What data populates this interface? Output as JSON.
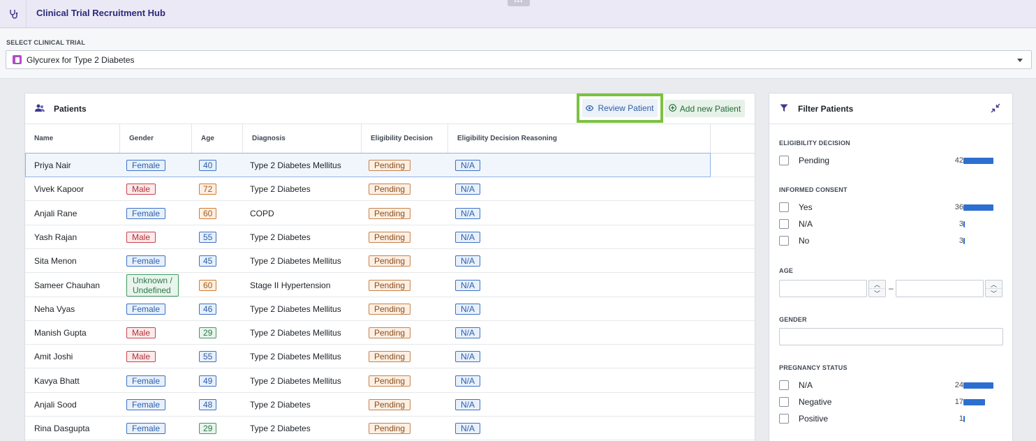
{
  "app": {
    "title": "Clinical Trial Recruitment Hub",
    "grip": "•••"
  },
  "trial": {
    "label": "SELECT CLINICAL TRIAL",
    "selected": "Glycurex for Type 2 Diabetes"
  },
  "patients": {
    "title": "Patients",
    "review_label": "Review Patient",
    "add_label": "Add new Patient",
    "columns": [
      "Name",
      "Gender",
      "Age",
      "Diagnosis",
      "Eligibility Decision",
      "Eligibility Decision Reasoning"
    ],
    "rows": [
      {
        "name": "Priya Nair",
        "gender": "Female",
        "age": "40",
        "diagnosis": "Type 2 Diabetes Mellitus",
        "decision": "Pending",
        "reasoning": "N/A"
      },
      {
        "name": "Vivek Kapoor",
        "gender": "Male",
        "age": "72",
        "diagnosis": "Type 2 Diabetes",
        "decision": "Pending",
        "reasoning": "N/A"
      },
      {
        "name": "Anjali Rane",
        "gender": "Female",
        "age": "60",
        "diagnosis": "COPD",
        "decision": "Pending",
        "reasoning": "N/A"
      },
      {
        "name": "Yash Rajan",
        "gender": "Male",
        "age": "55",
        "diagnosis": "Type 2 Diabetes",
        "decision": "Pending",
        "reasoning": "N/A"
      },
      {
        "name": "Sita Menon",
        "gender": "Female",
        "age": "45",
        "diagnosis": "Type 2 Diabetes Mellitus",
        "decision": "Pending",
        "reasoning": "N/A"
      },
      {
        "name": "Sameer Chauhan",
        "gender": "Unknown / Undefined",
        "gender_line1": "Unknown /",
        "gender_line2": "Undefined",
        "age": "60",
        "diagnosis": "Stage II Hypertension",
        "decision": "Pending",
        "reasoning": "N/A"
      },
      {
        "name": "Neha Vyas",
        "gender": "Female",
        "age": "46",
        "diagnosis": "Type 2 Diabetes Mellitus",
        "decision": "Pending",
        "reasoning": "N/A"
      },
      {
        "name": "Manish Gupta",
        "gender": "Male",
        "age": "29",
        "diagnosis": "Type 2 Diabetes Mellitus",
        "decision": "Pending",
        "reasoning": "N/A"
      },
      {
        "name": "Amit Joshi",
        "gender": "Male",
        "age": "55",
        "diagnosis": "Type 2 Diabetes Mellitus",
        "decision": "Pending",
        "reasoning": "N/A"
      },
      {
        "name": "Kavya Bhatt",
        "gender": "Female",
        "age": "49",
        "diagnosis": "Type 2 Diabetes Mellitus",
        "decision": "Pending",
        "reasoning": "N/A"
      },
      {
        "name": "Anjali Sood",
        "gender": "Female",
        "age": "48",
        "diagnosis": "Type 2 Diabetes",
        "decision": "Pending",
        "reasoning": "N/A"
      },
      {
        "name": "Rina Dasgupta",
        "gender": "Female",
        "age": "29",
        "diagnosis": "Type 2 Diabetes",
        "decision": "Pending",
        "reasoning": "N/A"
      }
    ]
  },
  "filter": {
    "title": "Filter Patients",
    "eligibility": {
      "label": "ELIGIBILITY DECISION",
      "options": [
        {
          "label": "Pending",
          "count": "42"
        }
      ]
    },
    "consent": {
      "label": "INFORMED CONSENT",
      "options": [
        {
          "label": "Yes",
          "count": "36"
        },
        {
          "label": "N/A",
          "count": "3"
        },
        {
          "label": "No",
          "count": "3"
        }
      ]
    },
    "age": {
      "label": "AGE",
      "separator": "–"
    },
    "gender": {
      "label": "GENDER"
    },
    "pregnancy": {
      "label": "PREGNANCY STATUS",
      "options": [
        {
          "label": "N/A",
          "count": "24"
        },
        {
          "label": "Negative",
          "count": "17"
        },
        {
          "label": "Positive",
          "count": "1"
        }
      ]
    }
  },
  "colors": {
    "accent": "#2b2a7a",
    "highlight": "#7cc142",
    "bar": "#2d6fd0"
  }
}
